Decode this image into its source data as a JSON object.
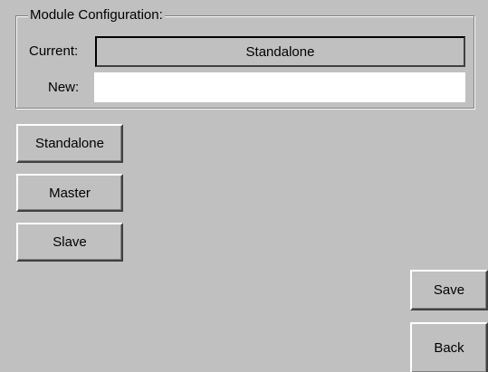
{
  "module_config": {
    "group_title": "Module Configuration:",
    "current_label": "Current:",
    "current_value": "Standalone",
    "new_label": "New:",
    "new_value": ""
  },
  "mode_buttons": {
    "standalone": "Standalone",
    "master": "Master",
    "slave": "Slave"
  },
  "actions": {
    "save": "Save",
    "back": "Back"
  }
}
